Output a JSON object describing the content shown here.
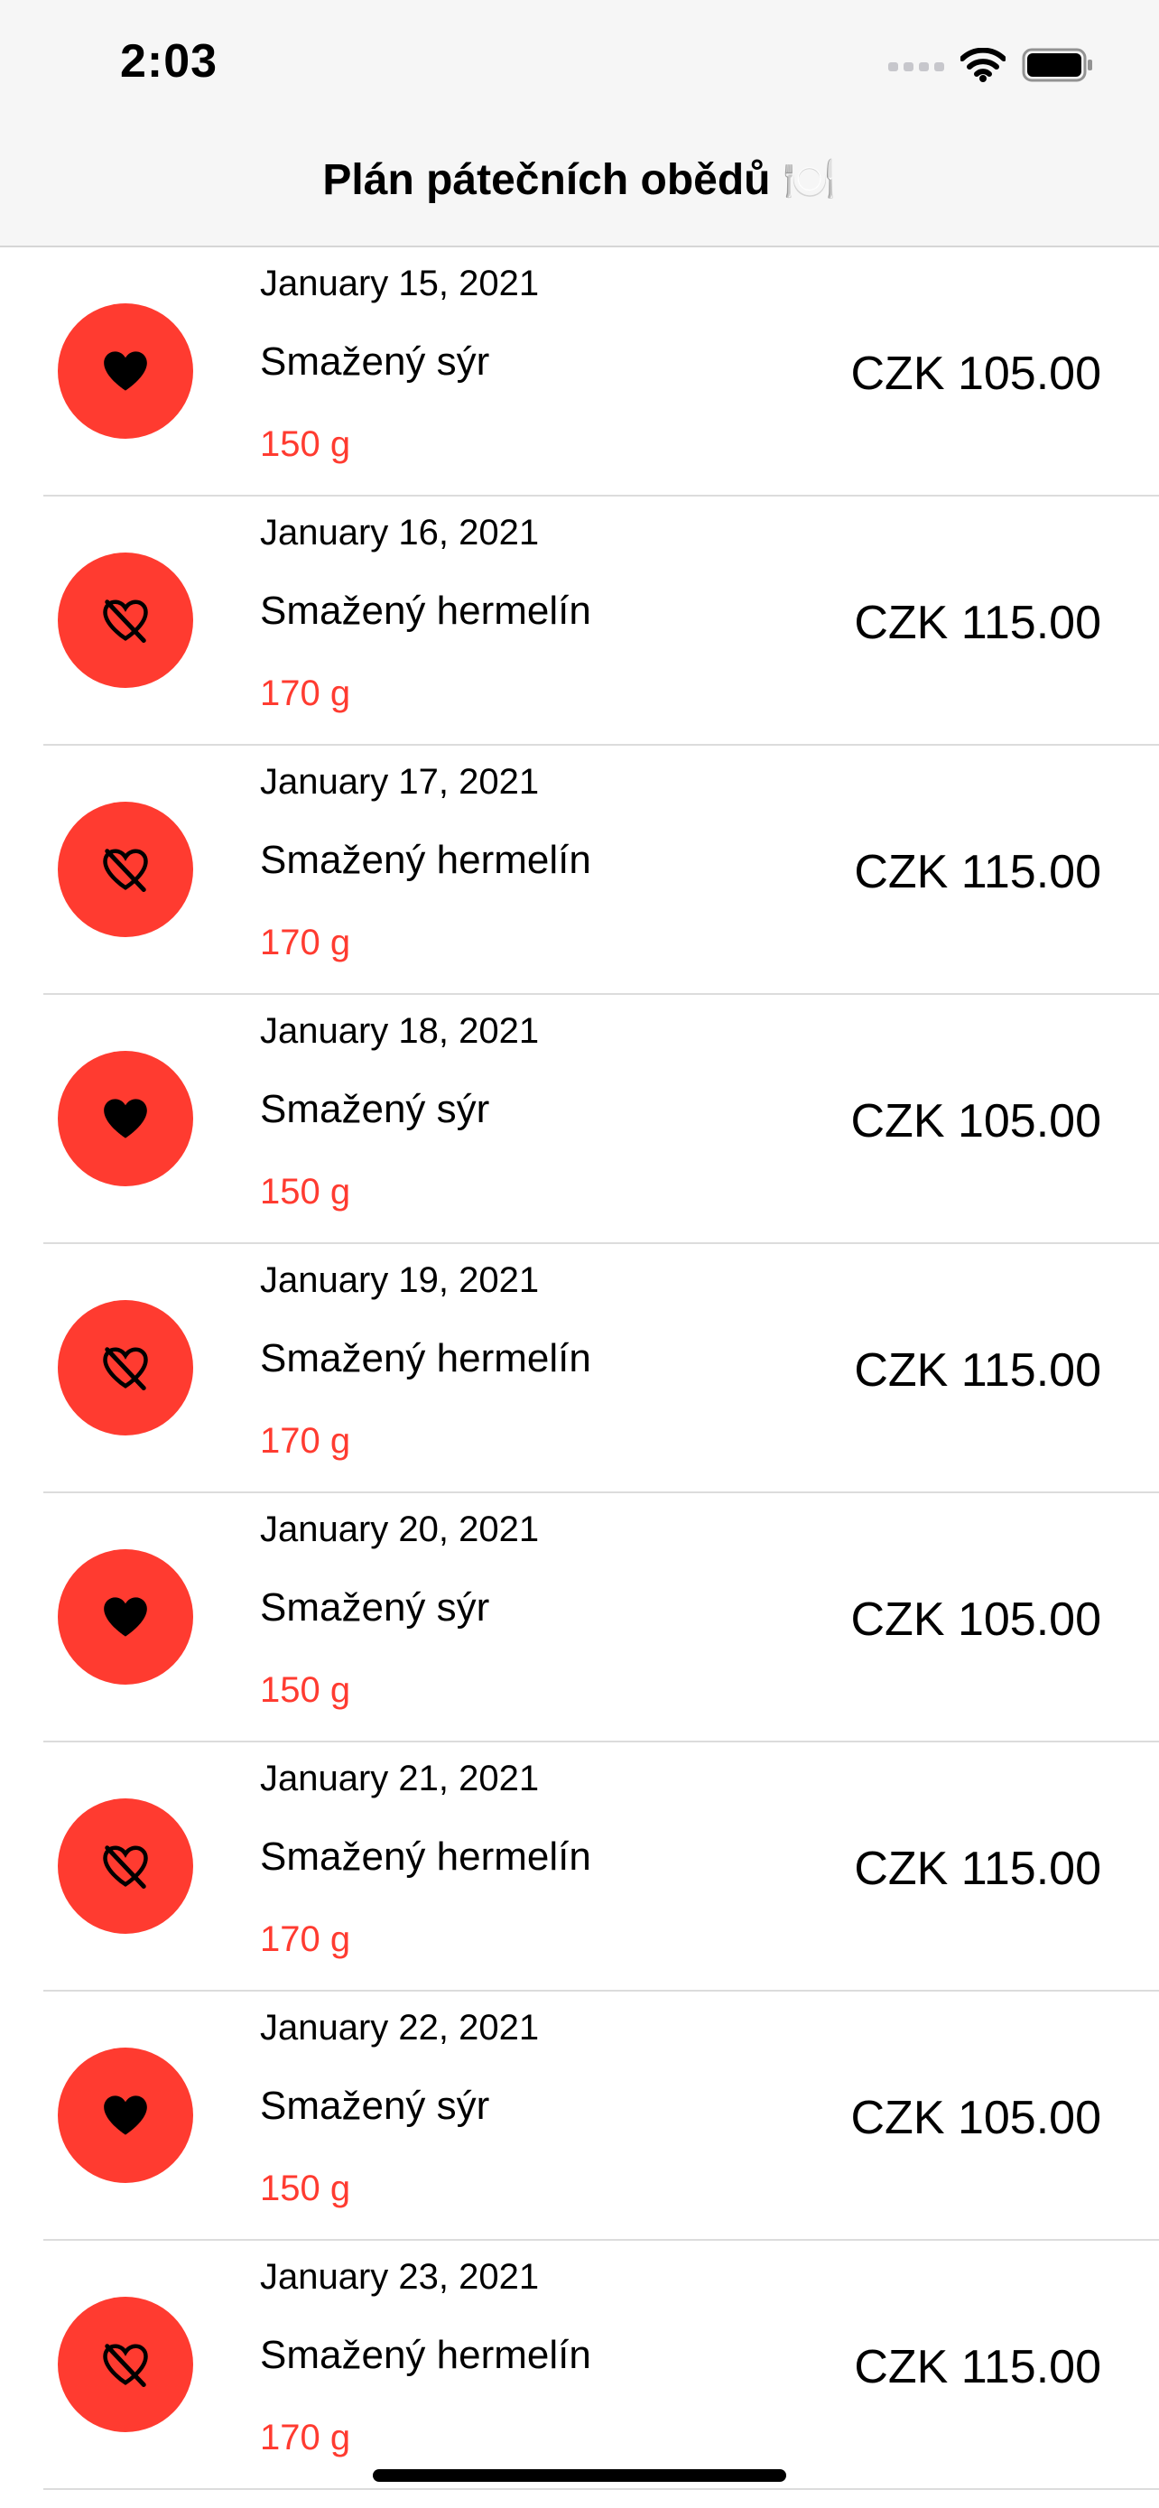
{
  "status_bar": {
    "time": "2:03"
  },
  "nav": {
    "title": "Plán pátečních obědů 🍽️"
  },
  "items": [
    {
      "date": "January 15, 2021",
      "name": "Smažený sýr",
      "weight": "150 g",
      "price": "CZK 105.00",
      "favorite": true
    },
    {
      "date": "January 16, 2021",
      "name": "Smažený hermelín",
      "weight": "170 g",
      "price": "CZK 115.00",
      "favorite": false
    },
    {
      "date": "January 17, 2021",
      "name": "Smažený hermelín",
      "weight": "170 g",
      "price": "CZK 115.00",
      "favorite": false
    },
    {
      "date": "January 18, 2021",
      "name": "Smažený sýr",
      "weight": "150 g",
      "price": "CZK 105.00",
      "favorite": true
    },
    {
      "date": "January 19, 2021",
      "name": "Smažený hermelín",
      "weight": "170 g",
      "price": "CZK 115.00",
      "favorite": false
    },
    {
      "date": "January 20, 2021",
      "name": "Smažený sýr",
      "weight": "150 g",
      "price": "CZK 105.00",
      "favorite": true
    },
    {
      "date": "January 21, 2021",
      "name": "Smažený hermelín",
      "weight": "170 g",
      "price": "CZK 115.00",
      "favorite": false
    },
    {
      "date": "January 22, 2021",
      "name": "Smažený sýr",
      "weight": "150 g",
      "price": "CZK 105.00",
      "favorite": true
    },
    {
      "date": "January 23, 2021",
      "name": "Smažený hermelín",
      "weight": "170 g",
      "price": "CZK 115.00",
      "favorite": false
    }
  ],
  "colors": {
    "accent": "#ff3b30",
    "navbar": "#f6f6f6",
    "separator": "#dcdcdc"
  },
  "icons": {
    "favorite": "heart-icon",
    "not_favorite": "heart-slash-icon"
  }
}
